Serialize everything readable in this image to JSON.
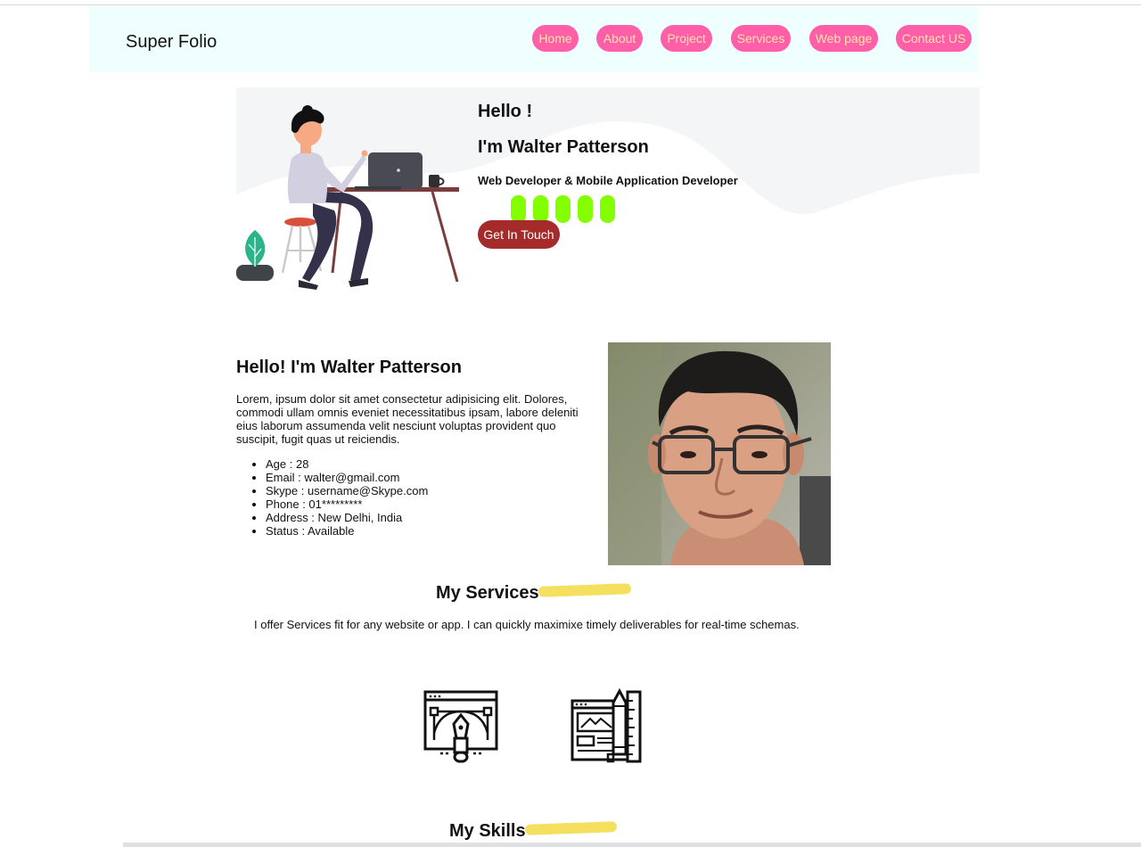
{
  "navbar": {
    "brand": "Super Folio",
    "items": [
      "Home",
      "About",
      "Project",
      "Services",
      "Web page",
      "Contact US"
    ]
  },
  "hero": {
    "greeting": "Hello !",
    "name": "I'm Walter Patterson",
    "role": "Web Developer & Mobile Application Developer",
    "cta": "Get In Touch"
  },
  "about": {
    "title": "Hello! I'm Walter Patterson",
    "text": "Lorem, ipsum dolor sit amet consectetur adipisicing elit. Dolores, commodi ullam omnis eveniet necessitatibus ipsam, labore deleniti eius laborum assumenda velit nesciunt voluptas provident quo suscipit, fugit quas ut reiciendis.",
    "details": [
      "Age : 28",
      "Email : walter@gmail.com",
      "Skype : username@Skype.com",
      "Phone : 01*********",
      "Address : New Delhi, India",
      "Status : Available"
    ]
  },
  "services": {
    "title": "My Services",
    "description": "I offer Services fit for any website or app. I can quickly maximixe timely deliverables for real-time schemas."
  },
  "skills": {
    "title": "My Skills"
  },
  "colors": {
    "nav_bg": "#eefffe",
    "nav_pill": "#ff5fa8",
    "nav_text": "#ffe6a8",
    "cta": "#a52a2a",
    "social": "#84ff00",
    "highlight": "#f5df5e"
  }
}
